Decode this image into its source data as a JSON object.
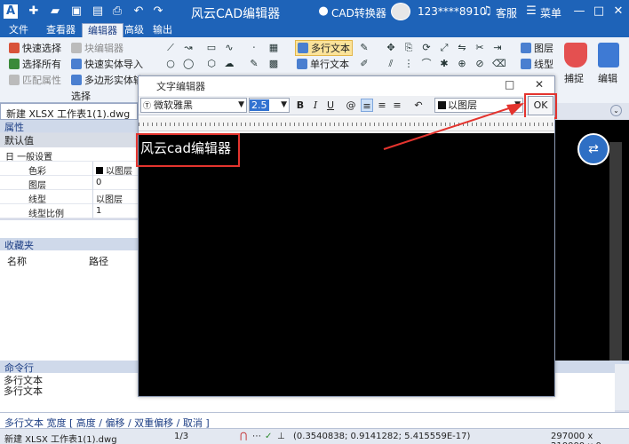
{
  "app": {
    "title": "风云CAD编辑器",
    "cad_convert": "CAD转换器",
    "user": "123****8910",
    "service": "客服",
    "menu": "菜单",
    "window_controls": [
      "—",
      "□",
      "✕"
    ]
  },
  "ribbon_tabs": [
    {
      "label": "文件",
      "active": false
    },
    {
      "label": "查看器",
      "active": false
    },
    {
      "label": "编辑器",
      "active": true
    },
    {
      "label": "高级",
      "active": false
    },
    {
      "label": "输出",
      "active": false
    }
  ],
  "ribbon": {
    "select_group": [
      "快速选择",
      "选择所有",
      "匹配属性",
      "选择"
    ],
    "block_group": [
      "块编辑器",
      "快速实体导入",
      "多边形实体输"
    ],
    "text_group": [
      "多行文本",
      "单行文本"
    ],
    "layer_group": [
      "图层",
      "线型"
    ],
    "right_buttons": [
      "捕捉",
      "编辑"
    ]
  },
  "document_tab": {
    "label": "新建 XLSX 工作表1(1).dwg",
    "close": "✕"
  },
  "properties": {
    "header": "属性",
    "default_value": "默认值",
    "section": "日 一般设置",
    "rows": [
      {
        "key": "色彩",
        "value": "以图层"
      },
      {
        "key": "图层",
        "value": "0"
      },
      {
        "key": "线型",
        "value": "以图层"
      },
      {
        "key": "线型比例",
        "value": "1"
      }
    ]
  },
  "favorites": {
    "header": "收藏夹",
    "col_name": "名称",
    "col_path": "路径"
  },
  "command": {
    "header": "命令行",
    "history": [
      "多行文本",
      "多行文本"
    ],
    "prompt": "多行文本 宽度 [ 高度 / 偏移 / 双重偏移 / 取消 ]"
  },
  "status": {
    "file": "新建 XLSX 工作表1(1).dwg",
    "page": "1/3",
    "coords": "(0.3540838; 0.9141282; 5.415559E-17)",
    "paper": "297000 x 210000 x 0"
  },
  "dialog": {
    "title": "文字编辑器",
    "font": "微软雅黑",
    "size": "2.5",
    "bold": "B",
    "italic": "I",
    "underline": "U",
    "at": "@",
    "undo": "↶",
    "layer": "以图层",
    "ok": "OK",
    "content": "风云cad编辑器"
  },
  "colors": {
    "brand": "#1e63b8",
    "highlight": "#e4342e",
    "canvas": "#000000"
  },
  "icons": [
    "app-logo-icon",
    "new-icon",
    "open-icon",
    "save-icon",
    "print-icon",
    "undo-icon",
    "redo-icon",
    "cad-convert-icon",
    "headset-icon",
    "menu-icon",
    "translate-icon",
    "magnet-icon"
  ]
}
